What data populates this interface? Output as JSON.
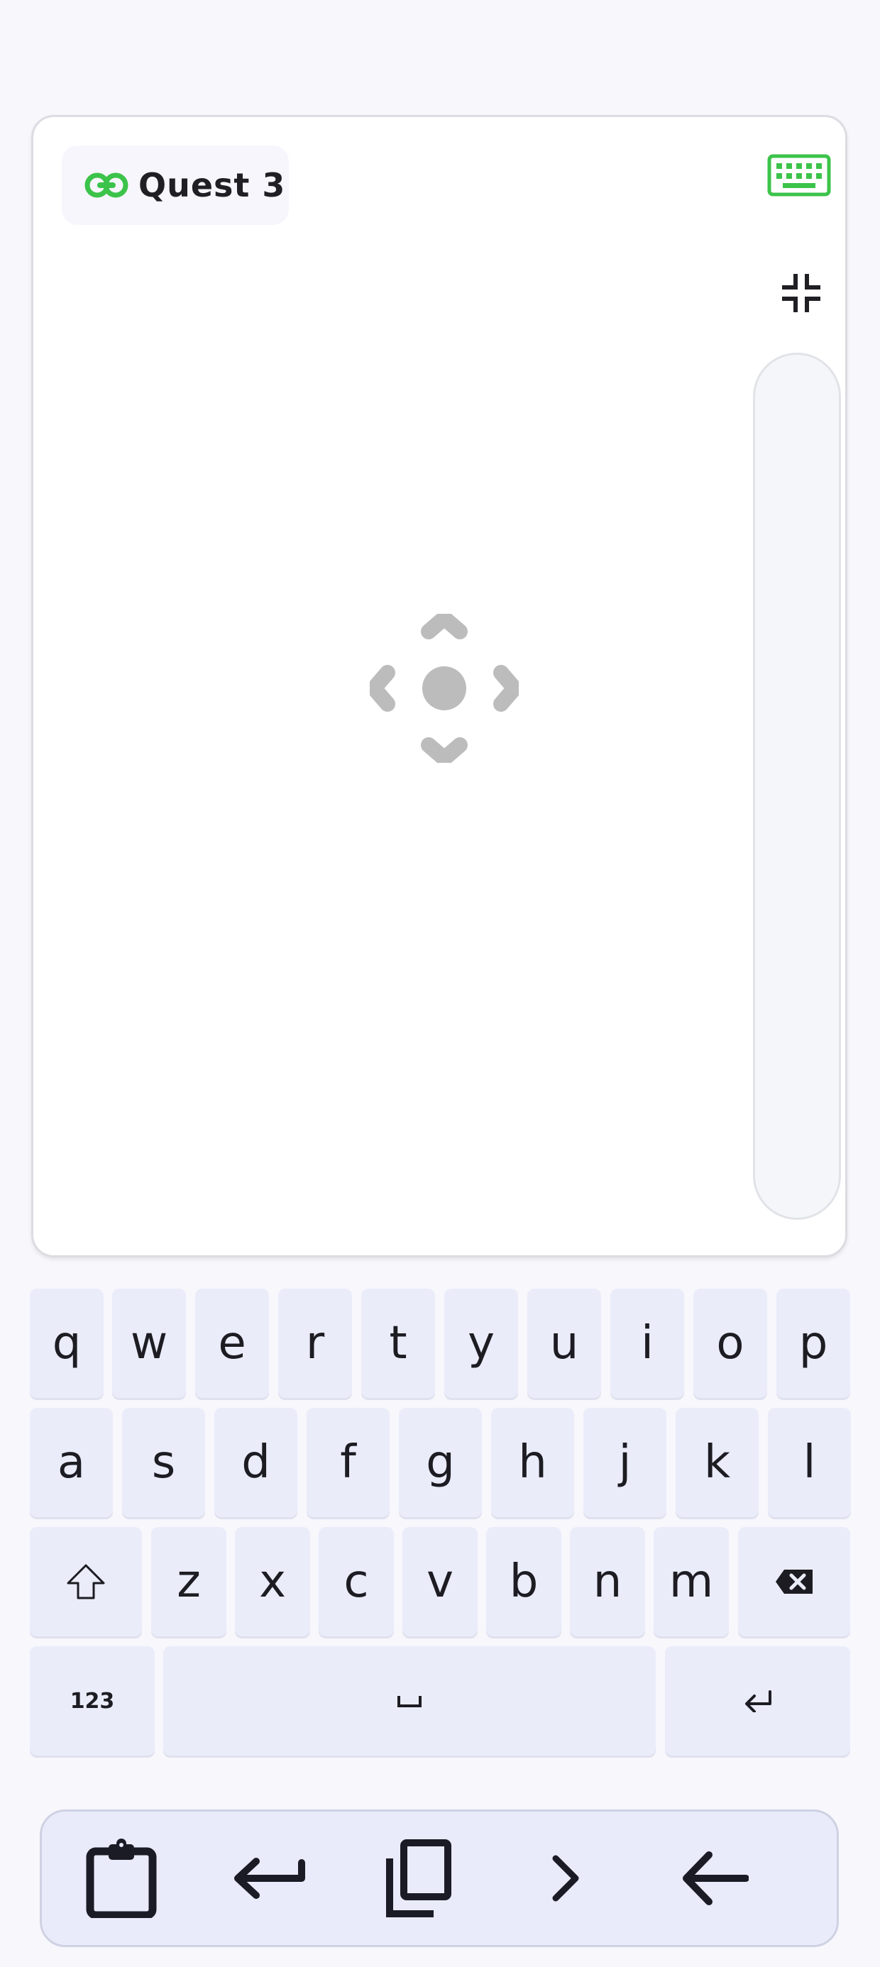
{
  "device": {
    "name": "Quest 3",
    "status_color": "#3cc34a"
  },
  "icons": {
    "link": "link-icon",
    "keyboard_toggle": "keyboard-icon",
    "collapse": "fullscreen-exit-icon",
    "dpad": "move-arrows-icon",
    "shift": "shift-icon",
    "backspace": "backspace-icon",
    "space": "space-bar-icon",
    "enter": "enter-icon"
  },
  "keyboard": {
    "row1": [
      "q",
      "w",
      "e",
      "r",
      "t",
      "y",
      "u",
      "i",
      "o",
      "p"
    ],
    "row2": [
      "a",
      "s",
      "d",
      "f",
      "g",
      "h",
      "j",
      "k",
      "l"
    ],
    "row3": [
      "z",
      "x",
      "c",
      "v",
      "b",
      "n",
      "m"
    ],
    "numbers_label": "123"
  },
  "toolbar": {
    "items": [
      "clipboard-icon",
      "enter-icon",
      "copy-icon",
      "chevron-right-icon",
      "arrow-back-icon"
    ]
  }
}
